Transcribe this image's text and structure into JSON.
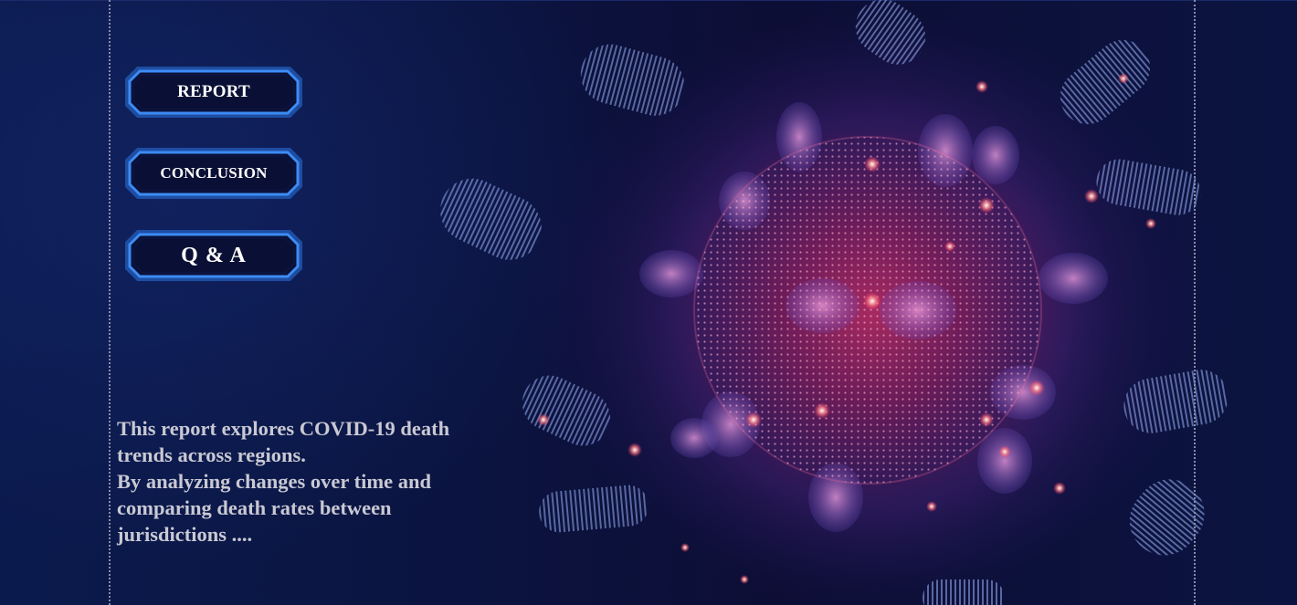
{
  "nav": {
    "report_label": "REPORT",
    "conclusion_label": "CONCLUSION",
    "qa_label": "Q & A"
  },
  "intro": {
    "line1": "This report explores COVID-19 death trends across regions.",
    "line2": "By analyzing changes over time and comparing death rates between jurisdictions ...."
  },
  "colors": {
    "background": "#0a0f33",
    "button_border": "#2f7fe8",
    "button_fill": "#0a1035",
    "text": "#c9c9d3",
    "virus_core": "#e0306a"
  },
  "art": {
    "icon": "coronavirus-illustration-icon"
  }
}
